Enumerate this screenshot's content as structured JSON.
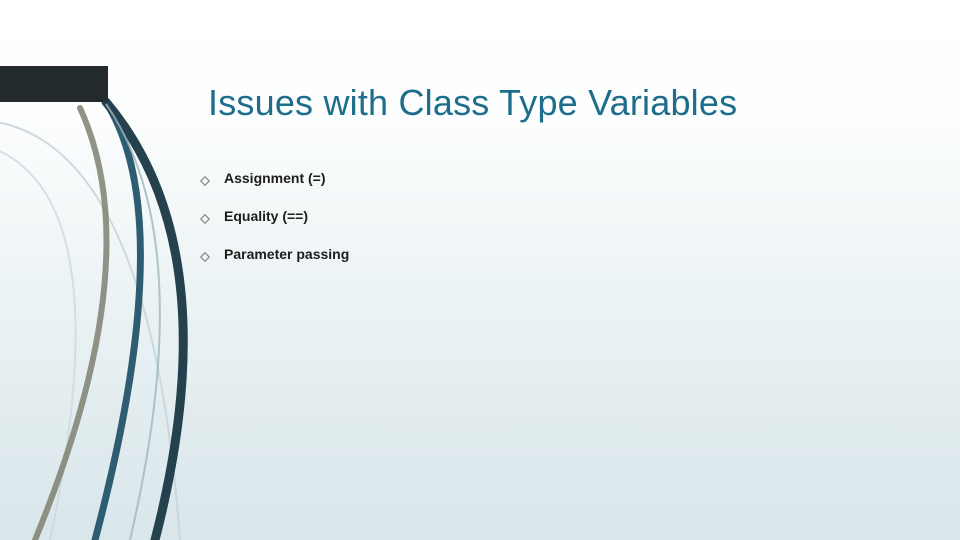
{
  "slide": {
    "title": "Issues with Class Type Variables",
    "bullets": [
      {
        "text": "Assignment (=)"
      },
      {
        "text": "Equality (==)"
      },
      {
        "text": "Parameter passing"
      }
    ]
  },
  "theme": {
    "title_color": "#1e6d8c",
    "bullet_color": "#8a8e82",
    "bar_color": "#222a2e",
    "curve_dark": "#2b4d5c",
    "curve_mid": "#6b8c99",
    "curve_light": "#c3d3d9"
  }
}
